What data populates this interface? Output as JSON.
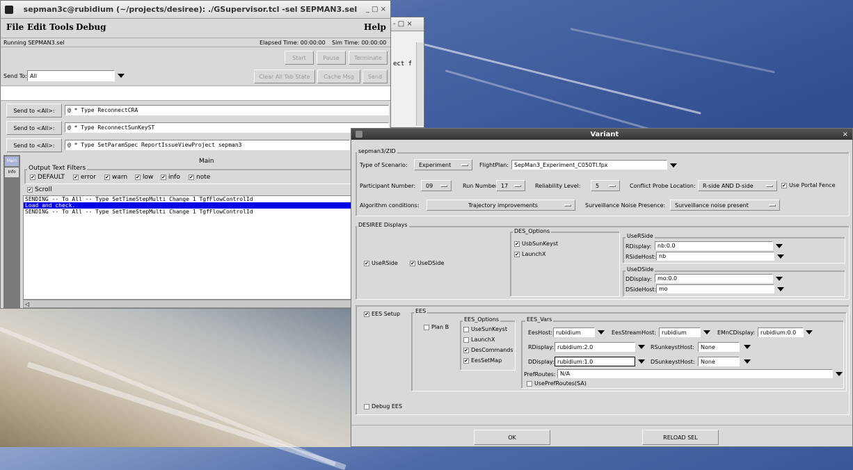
{
  "supervisor": {
    "title": "sepman3c@rubidium (~/projects/desiree): ./GSupervisor.tcl -sel SEPMAN3.sel",
    "title_controls": "_ □ ×",
    "menu": [
      "File",
      "Edit",
      "Tools",
      "Debug"
    ],
    "help": "Help",
    "status_left": "Running SEPMAN3.sel",
    "elapsed": "Elapsed Time: 00:00:00",
    "sim": "Sim Time: 00:00:00",
    "start": "Start",
    "pause": "Pause",
    "terminate": "Terminate",
    "send_to_label": "Send To:",
    "send_to_value": "All",
    "clear_tab": "Clear All Tab State",
    "cache_msg": "Cache Msg",
    "send": "Send",
    "commands": [
      {
        "button": "Send to <All>:",
        "text": "@ * Type ReconnectCRA"
      },
      {
        "button": "Send to <All>:",
        "text": "@ * Type ReconnectSunKeyST"
      },
      {
        "button": "Send to <All>:",
        "text": "@ * Type SetParamSpec ReportIssueViewProject sepman3"
      }
    ],
    "tab_main": "Main",
    "tab_info": "Info",
    "main_header": "Main",
    "filters_title": "Output Text Filters",
    "filters": [
      "DEFAULT",
      "error",
      "warn",
      "low",
      "info",
      "note"
    ],
    "scroll": "Scroll",
    "log": [
      "SENDING -- To All -- Type SetTimeStepMulti Change 1 TgfFlowControlId",
      "Load and check.",
      "SENDING -- To All -- Type SetTimeStepMulti Change 1 TgfFlowControlId"
    ]
  },
  "background_window": {
    "controls": "- □ ×",
    "text": "ect f"
  },
  "variant": {
    "title": "Variant",
    "close": "×",
    "group_sepman": "sepman3/ZID",
    "scenario_label": "Type of Scenario:",
    "scenario_value": "Experiment",
    "flightplan_label": "FlightPlan:",
    "flightplan_value": "SepMan3_Experiment_C050TI.fpx",
    "participant_label": "Participant Number:",
    "participant_value": "09",
    "run_label": "Run Number:",
    "run_value": "17",
    "reliability_label": "Reliability Level:",
    "reliability_value": "5",
    "conflict_label": "Conflict Probe Location:",
    "conflict_value": "R-side AND D-side",
    "portal_fence": "Use Portal Fence",
    "algorithm_label": "Algorithm conditions:",
    "algorithm_value": "Trajectory improvements",
    "surv_label": "Surveillance Noise Presence:",
    "surv_value": "Surveillance noise present",
    "desiree_title": "DESIREE Displays",
    "use_rside": "UseRSide",
    "use_dside": "UseDSide",
    "des_options_title": "DES_Options",
    "des_options": [
      "UsbSunKeyst",
      "LaunchX"
    ],
    "userside_title": "UseRSide",
    "rdisplay_label": "RDisplay:",
    "rdisplay_value": "nb:0.0",
    "rsidehost_label": "RSideHost:",
    "rsidehost_value": "nb",
    "usedside_title": "UseDSide",
    "ddisplay_label": "DDisplay:",
    "ddisplay_value": "mo:0.0",
    "dsidehost_label": "DSideHost:",
    "dsidehost_value": "mo",
    "ees_setup": "EES Setup",
    "ees_title": "EES",
    "plan_b": "Plan B",
    "ees_options_title": "EES_Options",
    "ees_options": [
      "UseSunKeyst",
      "LaunchX",
      "DesCommands",
      "EesSetMap"
    ],
    "ees_vars_title": "EES_Vars",
    "eeshost_label": "EesHost:",
    "eeshost_value": "rubidium",
    "eesstream_label": "EesStreamHost:",
    "eesstream_value": "rubidium",
    "emnc_label": "EMnCDisplay:",
    "emnc_value": "rubidium:0.0",
    "ees_rdisplay_label": "RDisplay:",
    "ees_rdisplay_value": "rubidium:2.0",
    "rsunkeyst_label": "RSunkeystHost:",
    "rsunkeyst_value": "None",
    "ees_ddisplay_label": "DDisplay:",
    "ees_ddisplay_value": "rubidium:1.0",
    "dsunkeyst_label": "DSunkeystHost:",
    "dsunkeyst_value": "None",
    "prefroutes_label": "PrefRoutes:",
    "prefroutes_value": "N/A",
    "use_prefroutes": "UsePrefRoutes(SA)",
    "debug_ees": "Debug EES",
    "ok": "OK",
    "reload": "RELOAD SEL"
  }
}
